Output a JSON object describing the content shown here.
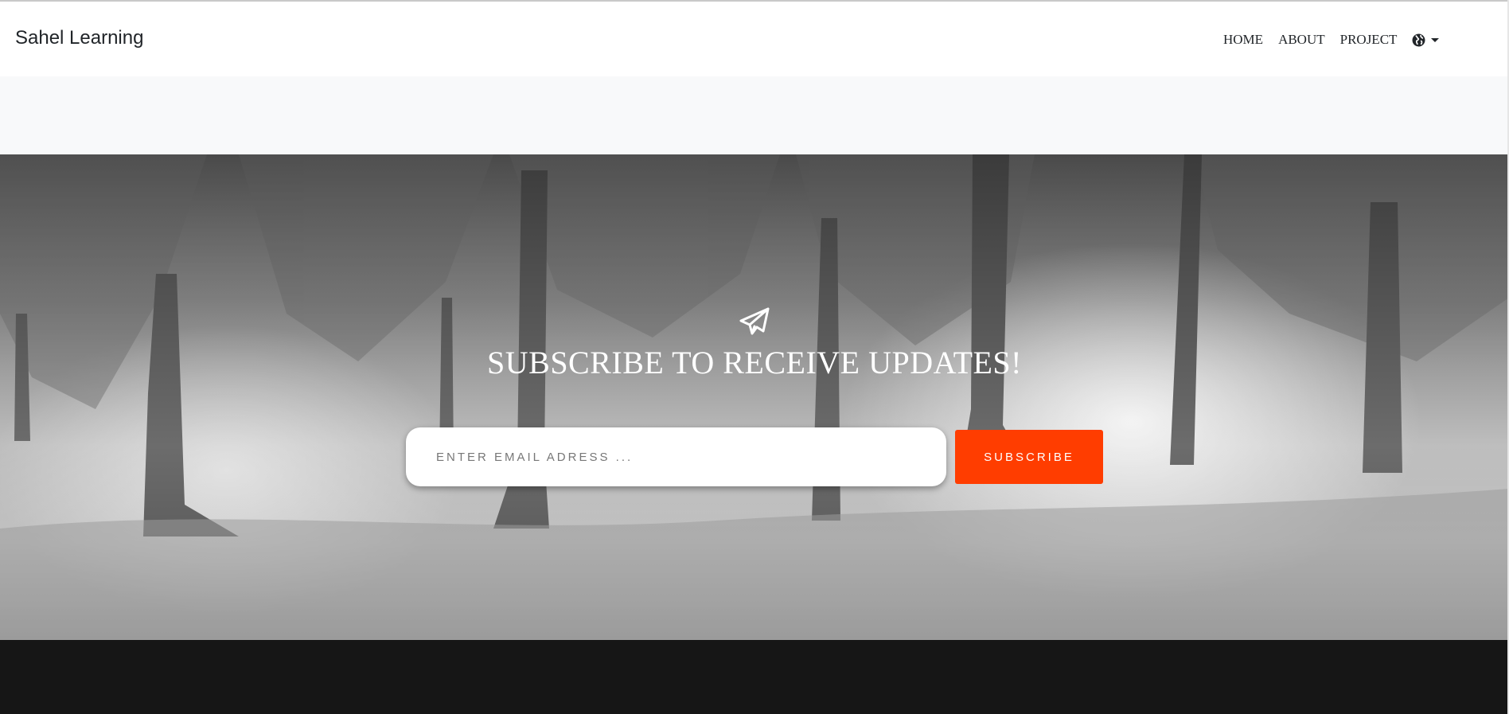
{
  "brand": "Sahel Learning",
  "nav": {
    "home": "HOME",
    "about": "ABOUT",
    "project": "PROJECT",
    "language_icon": "globe-icon"
  },
  "hero": {
    "icon": "paper-plane-icon",
    "title": "SUBSCRIBE TO RECEIVE UPDATES!",
    "email_placeholder": "ENTER EMAIL ADRESS ...",
    "button_label": "SUBSCRIBE"
  },
  "colors": {
    "accent": "#ff3d00",
    "footer": "#161616",
    "band": "#f8f9fa"
  }
}
